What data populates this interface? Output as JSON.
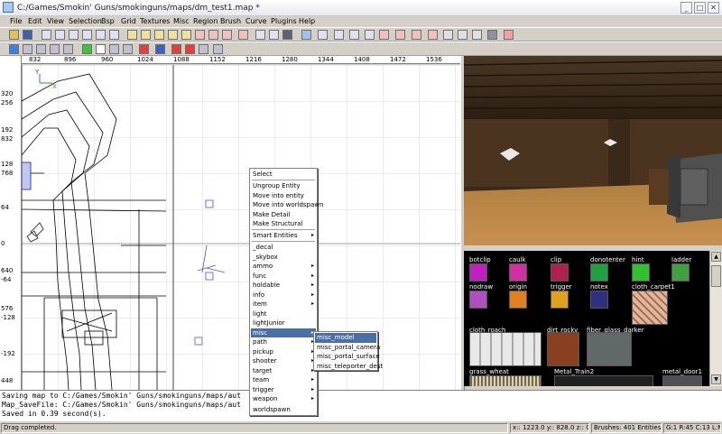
{
  "window": {
    "title": "C:/Games/Smokin' Guns/smokinguns/maps/dm_test1.map *"
  },
  "menubar": [
    "File",
    "Edit",
    "View",
    "Selection",
    "Bsp",
    "Grid",
    "Textures",
    "Misc",
    "Region",
    "Brush",
    "Curve",
    "Plugins",
    "Help"
  ],
  "view2d": {
    "ruler_top": [
      "832",
      "896",
      "960",
      "1024",
      "1088",
      "1152",
      "1216",
      "1280",
      "1344",
      "1408",
      "1472",
      "1536"
    ],
    "ruler_left": [
      "320",
      "256",
      "192",
      "832",
      "128",
      "768",
      "64",
      "0",
      "640",
      "-64",
      "576",
      "-128",
      "-192",
      "448"
    ],
    "axis_y": "Y",
    "axis_x": "X"
  },
  "context_menu": {
    "items": [
      {
        "label": "Select",
        "sub": false
      },
      {
        "label": "Ungroup Entity",
        "sub": false
      },
      {
        "label": "Move into entity",
        "sub": false
      },
      {
        "label": "Move into worldspawn",
        "sub": false
      },
      {
        "label": "Make Detail",
        "sub": false
      },
      {
        "label": "Make Structural",
        "sub": false
      },
      {
        "label": "Smart Entities",
        "sub": true
      },
      {
        "label": "_decal",
        "sub": false
      },
      {
        "label": "_skybox",
        "sub": false
      },
      {
        "label": "ammo",
        "sub": true
      },
      {
        "label": "func",
        "sub": true
      },
      {
        "label": "holdable",
        "sub": true
      },
      {
        "label": "info",
        "sub": true
      },
      {
        "label": "item",
        "sub": true
      },
      {
        "label": "light",
        "sub": false
      },
      {
        "label": "lightJunior",
        "sub": false
      },
      {
        "label": "misc",
        "sub": true,
        "selected": true
      },
      {
        "label": "path",
        "sub": true
      },
      {
        "label": "pickup",
        "sub": true
      },
      {
        "label": "shooter",
        "sub": true
      },
      {
        "label": "target",
        "sub": true
      },
      {
        "label": "team",
        "sub": true
      },
      {
        "label": "trigger",
        "sub": true
      },
      {
        "label": "weapon",
        "sub": true
      },
      {
        "label": "worldspawn",
        "sub": false
      }
    ],
    "submenu": [
      "misc_model",
      "misc_portal_camera",
      "misc_portal_surface",
      "misc_teleporter_dest"
    ]
  },
  "textures": [
    {
      "name": "botclip",
      "color": "#c020c0"
    },
    {
      "name": "caulk",
      "color": "#d030a0"
    },
    {
      "name": "clip",
      "color": "#b02050"
    },
    {
      "name": "donotenter",
      "color": "#20a040"
    },
    {
      "name": "hint",
      "color": "#30c030"
    },
    {
      "name": "ladder",
      "color": "#40a040"
    },
    {
      "name": "nodraw",
      "color": "#b050c0"
    },
    {
      "name": "origin",
      "color": "#e08020"
    },
    {
      "name": "trigger",
      "color": "#e0a020"
    },
    {
      "name": "notex",
      "color": "#303080"
    },
    {
      "name": "cloth_carpet1",
      "color": "#d8b8a0"
    },
    {
      "name": "cloth_roach",
      "color": "#d8d8d8"
    },
    {
      "name": "dirt_rocky",
      "color": "#8a4020"
    },
    {
      "name": "fiber_glass_darker",
      "color": "#606868"
    },
    {
      "name": "grass_wheat",
      "color": "#7a6a40"
    },
    {
      "name": "Metal_Train2",
      "color": "#202020"
    },
    {
      "name": "metal_door1",
      "color": "#505050"
    }
  ],
  "console": [
    "Saving map to C:/Games/Smokin' Guns/smokinguns/maps/aut",
    "Map_SaveFile: C:/Games/Smokin' Guns/smokinguns/maps/aut",
    "Saved in 0.39 second(s)."
  ],
  "status": {
    "message": "Drag completed.",
    "coords": "x:: 1223.0  y:: 828.0  z:: 0.0",
    "counts": "Brushes: 401 Entities: 31",
    "grid": "G:1 R:45 C:13 L:MR"
  }
}
